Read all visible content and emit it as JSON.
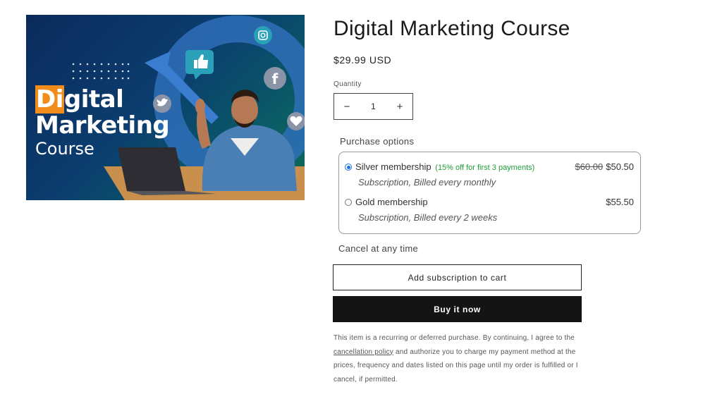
{
  "image": {
    "title_line1_highlight": "Di",
    "title_line1_rest": "gital",
    "title_line2": "Marketing",
    "title_line3": "Course",
    "icons": [
      "instagram-icon",
      "like-icon",
      "facebook-icon",
      "twitter-icon",
      "heart-icon",
      "growth-arrow-icon"
    ],
    "colors": {
      "background_start": "#0b2a5c",
      "background_end": "#0f6b55",
      "highlight": "#f28c1a"
    }
  },
  "product": {
    "title": "Digital Marketing Course",
    "price": "$29.99 USD"
  },
  "quantity": {
    "label": "Quantity",
    "value": "1",
    "decrease_symbol": "−",
    "increase_symbol": "+"
  },
  "purchase_options": {
    "label": "Purchase options",
    "options": [
      {
        "name": "Silver membership",
        "note": "(15% off for first 3 payments)",
        "old_price": "$60.00",
        "price": "$50.50",
        "description": "Subscription, Billed every monthly",
        "selected": true
      },
      {
        "name": "Gold membership",
        "note": "",
        "old_price": "",
        "price": "$55.50",
        "description": "Subscription, Billed every 2 weeks",
        "selected": false
      }
    ]
  },
  "cancel_text": "Cancel at any time",
  "buttons": {
    "add_to_cart": "Add subscription to cart",
    "buy_now": "Buy it now"
  },
  "disclaimer": {
    "before_link": "This item is a recurring or deferred purchase. By continuing, I agree to the ",
    "link_text": "cancellation policy",
    "after_link": " and authorize you to charge my payment method at the prices, frequency and dates listed on this page until my order is fulfilled or I cancel, if permitted."
  },
  "colors": {
    "accent_radio": "#1a6fdc",
    "discount_note": "#1f9d3a",
    "buy_button": "#141414"
  }
}
